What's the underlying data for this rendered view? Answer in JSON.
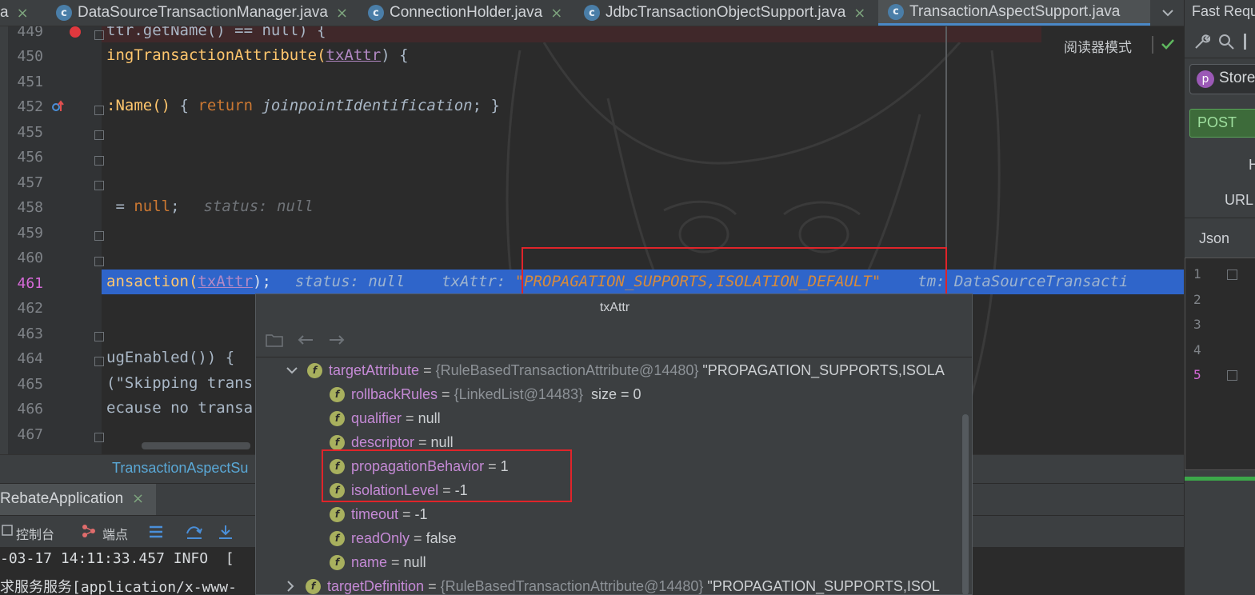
{
  "tabs": [
    {
      "label": "a",
      "close": "×"
    },
    {
      "label": "DataSourceTransactionManager.java",
      "close": "×"
    },
    {
      "label": "ConnectionHolder.java",
      "close": "×"
    },
    {
      "label": "JdbcTransactionObjectSupport.java",
      "close": "×"
    },
    {
      "label": "TransactionAspectSupport.java",
      "close": ""
    }
  ],
  "editor": {
    "reader_mode": "阅读器模式",
    "lines": [
      {
        "num": "449"
      },
      {
        "num": "450"
      },
      {
        "num": "451"
      },
      {
        "num": "452"
      },
      {
        "num": "455"
      },
      {
        "num": "456"
      },
      {
        "num": "457"
      },
      {
        "num": "458"
      },
      {
        "num": "459"
      },
      {
        "num": "460"
      },
      {
        "num": "461"
      },
      {
        "num": "462"
      },
      {
        "num": "463"
      },
      {
        "num": "464"
      },
      {
        "num": "465"
      },
      {
        "num": "466"
      },
      {
        "num": "467"
      }
    ],
    "code": {
      "l449": "ttr.getName() == null) {",
      "l450_a": "ingTransactionAttribute(",
      "l450_b": "txAttr",
      "l450_c": ") {",
      "l452_a": ":Name()",
      "l452_b": " { ",
      "l452_c": "return",
      "l452_d": " joinpointIdentification",
      "l452_e": "; }",
      "l458_a": " = ",
      "l458_b": "null",
      "l458_c": ";",
      "l458_hint": "status: null",
      "l461_a": "ansaction(",
      "l461_b": "txAttr",
      "l461_c": ");",
      "l461_hint1": "status: null",
      "l461_hint2": "txAttr: ",
      "l461_str": "\"PROPAGATION_SUPPORTS,ISOLATION_DEFAULT\"",
      "l461_hint3": "tm: DataSourceTransacti",
      "l464_a": "ugEnabled()) {",
      "l465": "(\"Skipping trans",
      "l466": "ecause no transa"
    }
  },
  "breadcrumb": "TransactionAspectSu",
  "run": {
    "tab": "RebateApplication",
    "close": "×"
  },
  "tool_tabs": {
    "console": "控制台",
    "endpoints": "端点"
  },
  "console_lines": [
    "-03-17 14:11:33.457 INFO  [",
    "求服务服务[application/x-www-"
  ],
  "side_panel": {
    "title": "Fast Requ",
    "store": "Store",
    "method": "POST",
    "h": "H",
    "url": "URL",
    "json": "Json",
    "lines": [
      "1",
      "2",
      "3",
      "4",
      "5"
    ]
  },
  "popup": {
    "title": "txAttr",
    "rows": [
      {
        "name": "targetAttribute",
        "eq": " = ",
        "ref": "{RuleBasedTransactionAttribute@14480}",
        "val": " \"PROPAGATION_SUPPORTS,ISOLA"
      },
      {
        "name": "rollbackRules",
        "eq": " = ",
        "ref": "{LinkedList@14483}",
        "val": "  size = 0"
      },
      {
        "name": "qualifier",
        "eq": " = ",
        "ref": "",
        "val": "null"
      },
      {
        "name": "descriptor",
        "eq": " = ",
        "ref": "",
        "val": "null"
      },
      {
        "name": "propagationBehavior",
        "eq": " = ",
        "ref": "",
        "val": "1"
      },
      {
        "name": "isolationLevel",
        "eq": " = ",
        "ref": "",
        "val": "-1"
      },
      {
        "name": "timeout",
        "eq": " = ",
        "ref": "",
        "val": "-1"
      },
      {
        "name": "readOnly",
        "eq": " = ",
        "ref": "",
        "val": "false"
      },
      {
        "name": "name",
        "eq": " = ",
        "ref": "",
        "val": "null"
      },
      {
        "name": "targetDefinition",
        "eq": " = ",
        "ref": "{RuleBasedTransactionAttribute@14480}",
        "val": " \"PROPAGATION_SUPPORTS,ISOL"
      }
    ]
  },
  "icons": {
    "field": "f",
    "class": "c",
    "profile": "p"
  }
}
